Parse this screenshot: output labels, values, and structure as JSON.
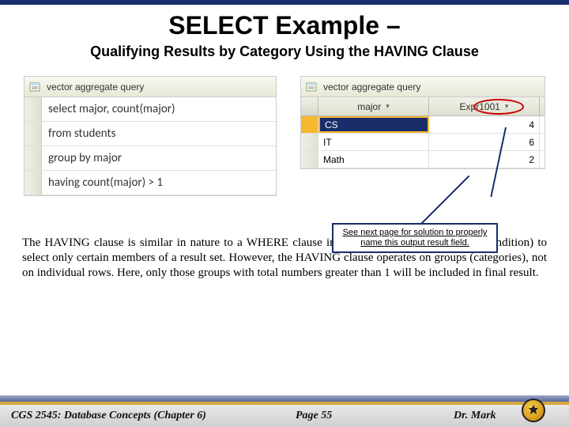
{
  "title": "SELECT Example –",
  "subtitle": "Qualifying Results by Category Using the HAVING Clause",
  "query_tab": "vector aggregate query",
  "code": {
    "l1": "select major, count(major)",
    "l2": "from students",
    "l3": "group by major",
    "l4": "having count(major) > 1"
  },
  "result": {
    "headers": {
      "major": "major",
      "expr": "Expr1001"
    },
    "rows": [
      {
        "major": "CS",
        "val": "4"
      },
      {
        "major": "IT",
        "val": "6"
      },
      {
        "major": "Math",
        "val": "2"
      }
    ]
  },
  "callout": "See next page for solution to properly name this output result field.",
  "body": "The HAVING clause is similar in nature to a WHERE clause in that it applies a predicate (or condition) to select only certain members of a result set.  However, the HAVING clause operates on groups (categories), not on individual rows. Here, only those groups with total numbers greater than 1 will be included in final result.",
  "footer": {
    "course": "CGS 2545: Database Concepts  (Chapter 6)",
    "page": "Page 55",
    "prof": "Dr. Mark"
  }
}
